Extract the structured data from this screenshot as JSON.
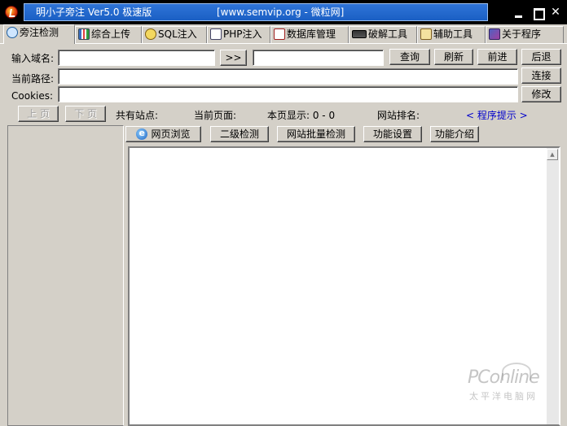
{
  "window": {
    "title": "明小子旁注 Ver5.0 极速版",
    "title_url": "[www.semvip.org - 微粒网]",
    "minimize_icon": "minimize-icon",
    "maximize_icon": "maximize-icon",
    "close_icon": "close-icon"
  },
  "tabs": [
    {
      "label": "旁注检测",
      "icon": "magnifier-icon"
    },
    {
      "label": "综合上传",
      "icon": "chart-icon"
    },
    {
      "label": "SQL注入",
      "icon": "sql-search-icon"
    },
    {
      "label": "PHP注入",
      "icon": "php-doc-icon"
    },
    {
      "label": "数据库管理",
      "icon": "database-icon"
    },
    {
      "label": "破解工具",
      "icon": "crack-tool-icon"
    },
    {
      "label": "辅助工具",
      "icon": "clipboard-icon"
    },
    {
      "label": "关于程序",
      "icon": "book-icon"
    }
  ],
  "form": {
    "domain_label": "输入域名:",
    "domain_value": "",
    "arrow_button": ">>",
    "ip_value": "",
    "query_button": "查询",
    "refresh_button": "刷新",
    "forward_button": "前进",
    "back_button": "后退",
    "path_label": "当前路径:",
    "path_value": "",
    "connect_button": "连接",
    "cookies_label": "Cookies:",
    "cookies_value": "",
    "modify_button": "修改"
  },
  "pager": {
    "prev_button": "上 页",
    "next_button": "下 页",
    "total_sites": "共有站点:",
    "current_page": "当前页面:",
    "page_display": "本页显示: 0 - 0",
    "site_rank": "网站排名:",
    "program_tip": "< 程序提示 >"
  },
  "subtoolbar": {
    "browse": "网页浏览",
    "second_level": "二级检测",
    "batch_check": "网站批量检测",
    "settings": "功能设置",
    "intro": "功能介绍"
  },
  "watermark": {
    "main": "PConline",
    "sub": "太平洋电脑网"
  }
}
